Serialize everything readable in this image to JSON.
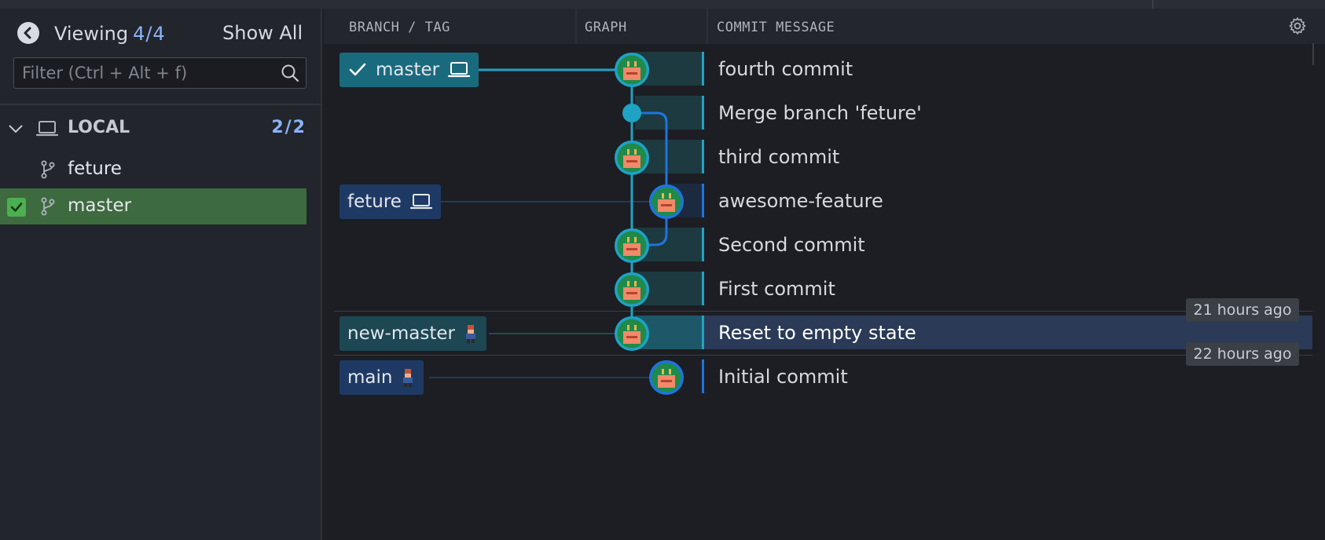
{
  "sidebar": {
    "viewing_label": "Viewing",
    "viewing_count": "4/4",
    "show_all_label": "Show All",
    "filter_placeholder": "Filter (Ctrl + Alt + f)",
    "local_label": "LOCAL",
    "local_count": "2/2",
    "branches": [
      {
        "label": "feture",
        "selected": false
      },
      {
        "label": "master",
        "selected": true
      }
    ]
  },
  "columns": {
    "branch_tag": "BRANCH / TAG",
    "graph": "GRAPH",
    "commit_message": "COMMIT MESSAGE"
  },
  "refs": {
    "master": "master",
    "feture": "feture",
    "new_master": "new-master",
    "main": "main"
  },
  "commits": [
    {
      "message": "fourth commit"
    },
    {
      "message": "Merge branch 'feture'"
    },
    {
      "message": "third commit"
    },
    {
      "message": "awesome-feature"
    },
    {
      "message": "Second commit"
    },
    {
      "message": "First commit"
    },
    {
      "message": "Reset to empty state",
      "selected": true
    },
    {
      "message": "Initial commit"
    }
  ],
  "timestamps": [
    "21 hours ago",
    "22 hours ago"
  ],
  "colors": {
    "accent_teal": "#1fa2c4",
    "accent_blue": "#1e74e0",
    "selected_branch_bg": "#3d6a3f",
    "selected_row_bg": "#2a3a57",
    "count_blue": "#8ab4f8"
  },
  "icons": [
    "back-arrow-icon",
    "search-icon",
    "chevron-down-icon",
    "laptop-icon",
    "branch-icon",
    "checkmark-icon",
    "gear-icon",
    "avatar-icon"
  ]
}
